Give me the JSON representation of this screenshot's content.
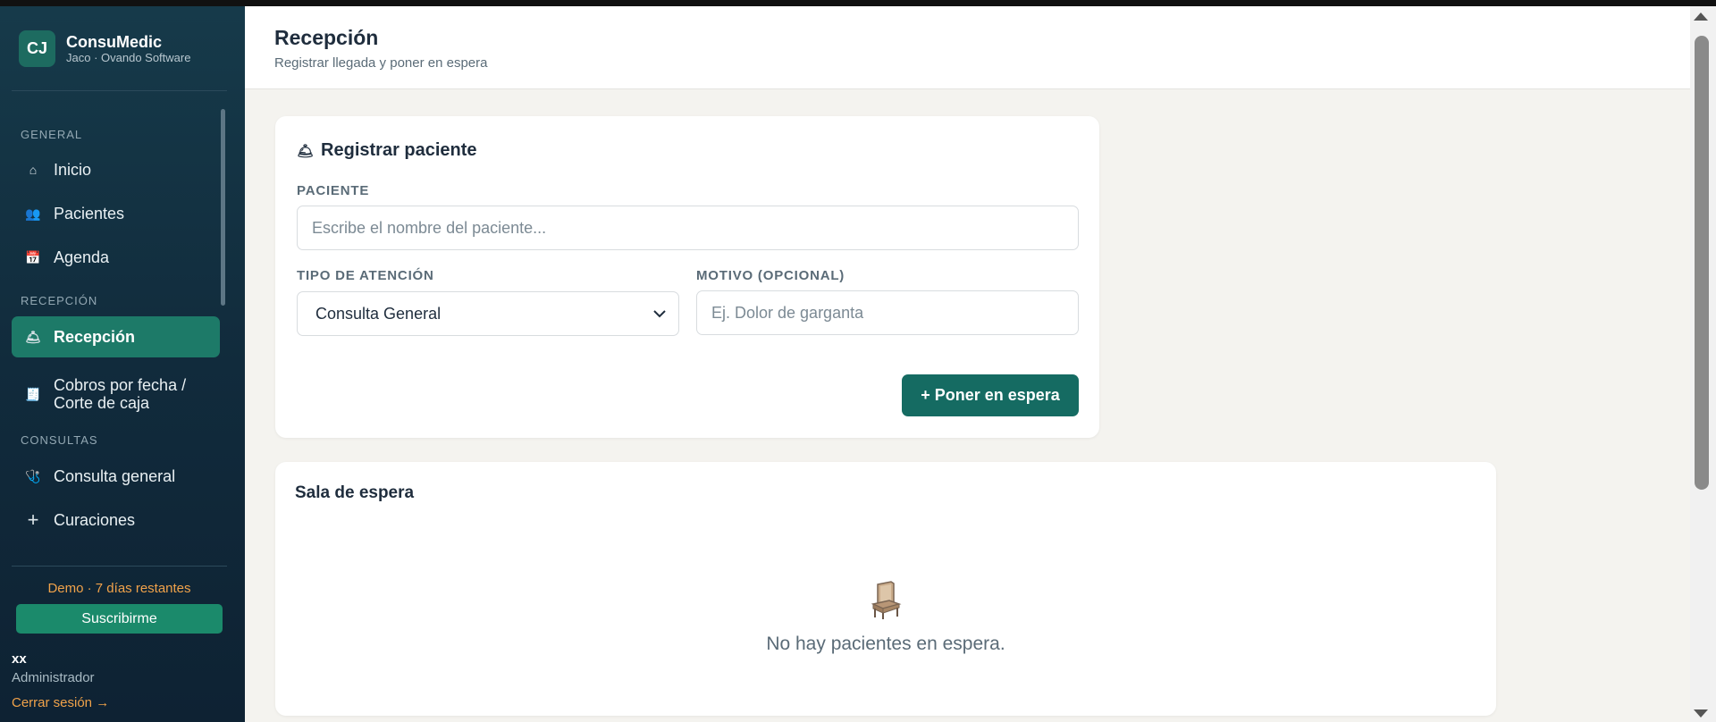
{
  "brand": {
    "initials": "CJ",
    "name": "ConsuMedic",
    "subtitle": "Jaco · Ovando Software"
  },
  "sidebar": {
    "sections": [
      "GENERAL",
      "RECEPCIÓN",
      "CONSULTAS"
    ],
    "items": [
      {
        "label": "Inicio",
        "icon": "⌂"
      },
      {
        "label": "Pacientes",
        "icon": "👥"
      },
      {
        "label": "Agenda",
        "icon": "📅"
      },
      {
        "label": "Recepción",
        "icon": "🛎"
      },
      {
        "label": "Cobros por fecha / Corte de caja",
        "icon": "🧾"
      },
      {
        "label": "Consulta general",
        "icon": "🩺"
      },
      {
        "label": "Curaciones",
        "icon": "+"
      }
    ],
    "demo_text": "Demo · 7 días restantes",
    "subscribe_label": "Suscribirme",
    "user_name": "xx",
    "user_role": "Administrador",
    "logout_label": "Cerrar sesión →"
  },
  "header": {
    "title": "Recepción",
    "subtitle": "Registrar llegada y poner en espera"
  },
  "register": {
    "title": "Registrar paciente",
    "title_icon": "🛎",
    "patient_label": "PACIENTE",
    "patient_placeholder": "Escribe el nombre del paciente...",
    "type_label": "TIPO DE ATENCIÓN",
    "type_value": "Consulta General",
    "reason_label": "MOTIVO (OPCIONAL)",
    "reason_placeholder": "Ej. Dolor de garganta",
    "submit_label": "+ Poner en espera"
  },
  "waiting": {
    "title": "Sala de espera",
    "empty_text": "No hay pacientes en espera."
  },
  "colors": {
    "accent": "#156b62",
    "active": "#1d7a68",
    "demo": "#f0a24a",
    "sidebar": "#143344"
  }
}
